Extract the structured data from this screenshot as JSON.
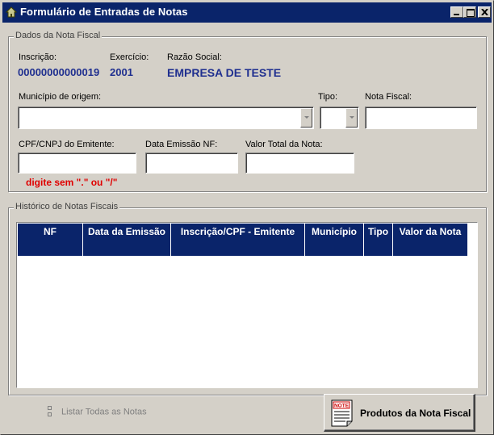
{
  "window": {
    "title": "Formulário de Entradas de Notas"
  },
  "dados": {
    "legend": "Dados da Nota Fiscal",
    "inscricao_label": "Inscrição:",
    "inscricao_value": "00000000000019",
    "exercicio_label": "Exercício:",
    "exercicio_value": "2001",
    "razao_label": "Razão Social:",
    "razao_value": "EMPRESA DE TESTE",
    "municipio_label": "Município de origem:",
    "municipio_value": "",
    "tipo_label": "Tipo:",
    "tipo_value": "",
    "nota_label": "Nota Fiscal:",
    "nota_value": "",
    "cpf_label": "CPF/CNPJ do Emitente:",
    "cpf_value": "",
    "data_label": "Data Emissão NF:",
    "data_value": "",
    "valor_label": "Valor Total da Nota:",
    "valor_value": "",
    "hint": "digite sem \".\" ou \"/\""
  },
  "historico": {
    "legend": "Histórico de Notas Fiscais",
    "columns": [
      "NF",
      "Data da Emissão",
      "Inscrição/CPF - Emitente",
      "Município",
      "Tipo",
      "Valor da Nota"
    ],
    "rows": [
      [
        "",
        "",
        "",
        "",
        "",
        ""
      ]
    ]
  },
  "footer": {
    "listar_label": "Listar Todas as Notas",
    "produtos_button": "Produtos da Nota Fiscal",
    "produtos_icon_text": "NOTE"
  },
  "colors": {
    "title_bar": "#0a246a",
    "value_text": "#1f2f8f",
    "warning": "#e00000",
    "face": "#d4d0c8"
  }
}
